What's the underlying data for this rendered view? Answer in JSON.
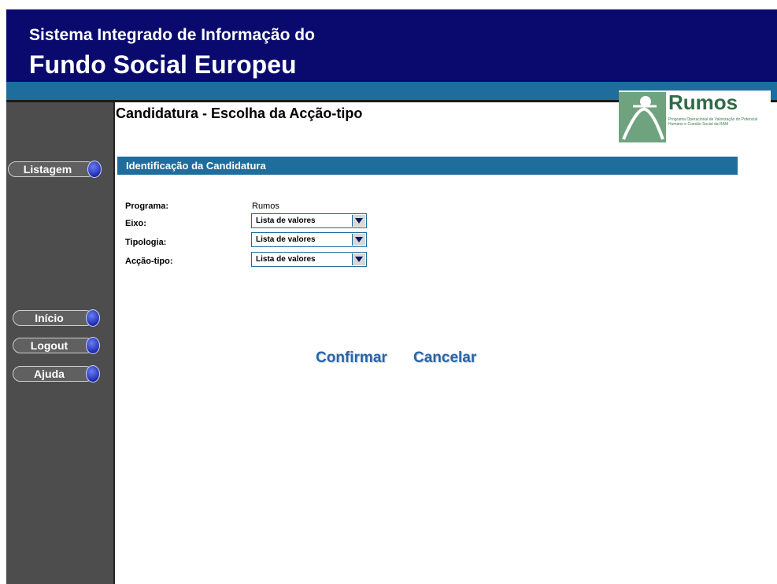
{
  "header": {
    "line1": "Sistema Integrado de Informação do",
    "line2": "Fundo Social Europeu"
  },
  "sidebar": {
    "buttons": [
      {
        "name": "listagem",
        "label": "Listagem"
      },
      {
        "name": "inicio",
        "label": "Início"
      },
      {
        "name": "logout",
        "label": "Logout"
      },
      {
        "name": "ajuda",
        "label": "Ajuda"
      }
    ]
  },
  "page": {
    "title": "Candidatura - Escolha da Acção-tipo"
  },
  "logo": {
    "name": "Rumos",
    "subtitle": "Programa Operacional de Valorização do Potencial Humano e Coesão Social da RAM",
    "icon": "rumos-logo-icon"
  },
  "section": {
    "title": "Identificação da Candidatura"
  },
  "form": {
    "programa": {
      "label": "Programa:",
      "value": "Rumos"
    },
    "eixo": {
      "label": "Eixo:",
      "value": "Lista de valores"
    },
    "tipologia": {
      "label": "Tipologia:",
      "value": "Lista de valores"
    },
    "accao_tipo": {
      "label": "Acção-tipo:",
      "value": "Lista de valores"
    }
  },
  "actions": {
    "confirmar": "Confirmar",
    "cancelar": "Cancelar"
  },
  "colors": {
    "header": "#0a0a6e",
    "accent": "#1e6d9c",
    "sidebar": "#4d4d4d",
    "action_link": "#2a65a8"
  }
}
